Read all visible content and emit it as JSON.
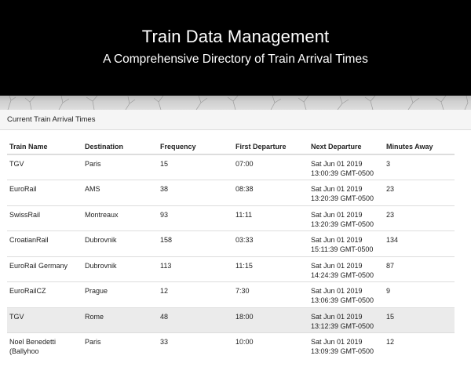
{
  "header": {
    "title": "Train Data Management",
    "subtitle": "A Comprehensive Directory of Train Arrival Times"
  },
  "panel": {
    "heading": "Current Train Arrival Times"
  },
  "table": {
    "columns": [
      "Train Name",
      "Destination",
      "Frequency",
      "First Departure",
      "Next Departure",
      "Minutes Away"
    ],
    "rows": [
      {
        "name": "TGV",
        "destination": "Paris",
        "frequency": "15",
        "first": "07:00",
        "next": "Sat Jun 01 2019 13:00:39 GMT-0500",
        "minutes": "3",
        "highlighted": false
      },
      {
        "name": "EuroRail",
        "destination": "AMS",
        "frequency": "38",
        "first": "08:38",
        "next": "Sat Jun 01 2019 13:20:39 GMT-0500",
        "minutes": "23",
        "highlighted": false
      },
      {
        "name": "SwissRail",
        "destination": "Montreaux",
        "frequency": "93",
        "first": "11:11",
        "next": "Sat Jun 01 2019 13:20:39 GMT-0500",
        "minutes": "23",
        "highlighted": false
      },
      {
        "name": "CroatianRail",
        "destination": "Dubrovnik",
        "frequency": "158",
        "first": "03:33",
        "next": "Sat Jun 01 2019 15:11:39 GMT-0500",
        "minutes": "134",
        "highlighted": false
      },
      {
        "name": "EuroRail Germany",
        "destination": "Dubrovnik",
        "frequency": "113",
        "first": "11:15",
        "next": "Sat Jun 01 2019 14:24:39 GMT-0500",
        "minutes": "87",
        "highlighted": false
      },
      {
        "name": "EuroRailCZ",
        "destination": "Prague",
        "frequency": "12",
        "first": "7:30",
        "next": "Sat Jun 01 2019 13:06:39 GMT-0500",
        "minutes": "9",
        "highlighted": false
      },
      {
        "name": "TGV",
        "destination": "Rome",
        "frequency": "48",
        "first": "18:00",
        "next": "Sat Jun 01 2019 13:12:39 GMT-0500",
        "minutes": "15",
        "highlighted": true
      },
      {
        "name": "Noel Benedetti (Ballyhoo",
        "destination": "Paris",
        "frequency": "33",
        "first": "10:00",
        "next": "Sat Jun 01 2019 13:09:39 GMT-0500",
        "minutes": "12",
        "highlighted": false
      }
    ]
  },
  "colors": {
    "hero_bg": "#000000",
    "panel_heading_bg": "#f5f5f5",
    "row_highlight": "#ebebeb",
    "border": "#dddddd"
  }
}
